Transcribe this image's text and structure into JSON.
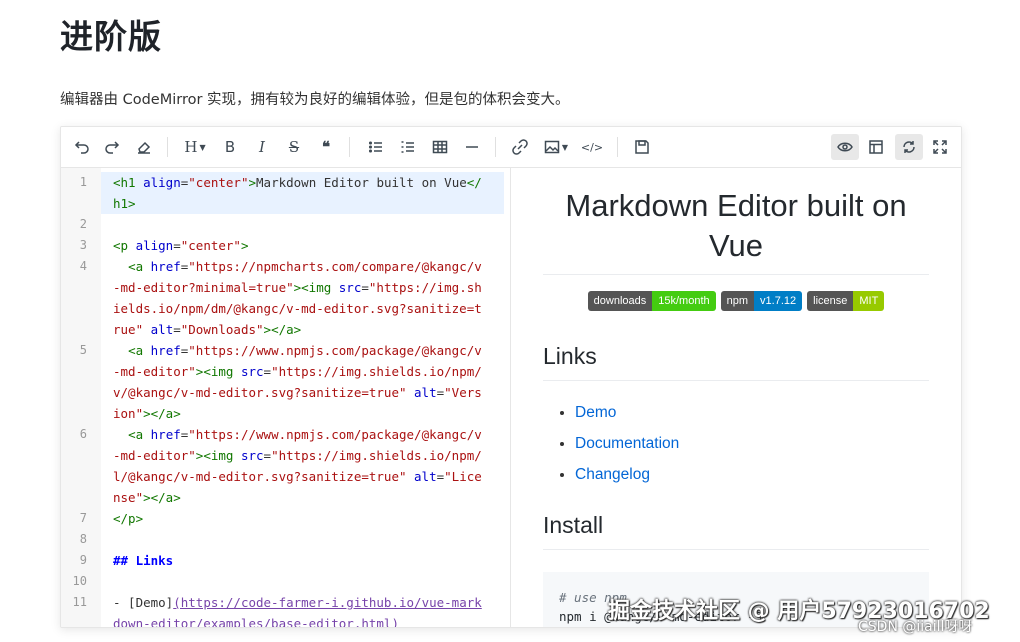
{
  "page": {
    "title": "进阶版",
    "intro": "编辑器由 CodeMirror 实现，拥有较为良好的编辑体验，但是包的体积会变大。"
  },
  "toolbar": {
    "items": [
      {
        "name": "undo-icon"
      },
      {
        "name": "redo-icon"
      },
      {
        "name": "clear-icon"
      },
      {
        "name": "heading-icon",
        "label": "H"
      },
      {
        "name": "bold-icon",
        "label": "B"
      },
      {
        "name": "italic-icon",
        "label": "I"
      },
      {
        "name": "strikethrough-icon",
        "label": "S"
      },
      {
        "name": "quote-icon",
        "label": "❝"
      },
      {
        "name": "unordered-list-icon"
      },
      {
        "name": "ordered-list-icon"
      },
      {
        "name": "table-icon"
      },
      {
        "name": "horizontal-rule-icon"
      },
      {
        "name": "link-icon"
      },
      {
        "name": "image-icon"
      },
      {
        "name": "code-icon",
        "label": "</>"
      },
      {
        "name": "save-icon"
      },
      {
        "name": "preview-icon"
      },
      {
        "name": "toc-icon"
      },
      {
        "name": "sync-scroll-icon"
      },
      {
        "name": "fullscreen-icon"
      }
    ]
  },
  "code": {
    "line_numbers": [
      "1",
      "",
      "2",
      "3",
      "4",
      "",
      "",
      "",
      "5",
      "",
      "",
      "",
      "6",
      "",
      "",
      "",
      "7",
      "8",
      "9",
      "10",
      "11",
      ""
    ]
  },
  "preview": {
    "h1": "Markdown Editor built on Vue",
    "badges": [
      {
        "left": "downloads",
        "right": "15k/month",
        "color": "#4c1"
      },
      {
        "left": "npm",
        "right": "v1.7.12",
        "color": "#007ec6"
      },
      {
        "left": "license",
        "right": "MIT",
        "color": "#97ca00"
      }
    ],
    "links_heading": "Links",
    "links": [
      "Demo",
      "Documentation",
      "Changelog"
    ],
    "install_heading": "Install",
    "install_comment": "# use npm",
    "install_cmd": "npm i @kangc/v-md-editor -S"
  },
  "watermark": {
    "main": "掘金技术社区 @ 用户57923016702",
    "sub": "CSDN @iiaill呀呀"
  }
}
